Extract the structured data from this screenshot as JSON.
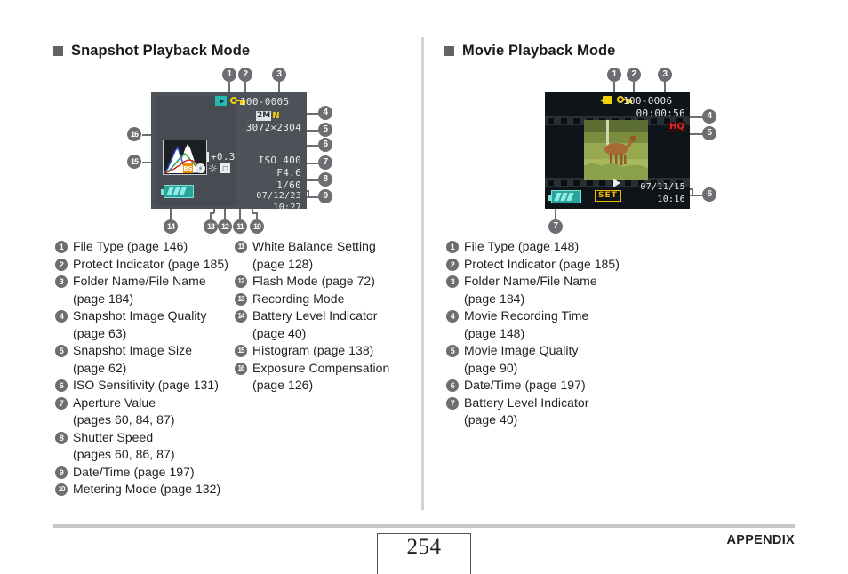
{
  "document": {
    "page_number": "254",
    "footer_label": "APPENDIX"
  },
  "sections": {
    "snapshot": {
      "heading": "Snapshot Playback Mode",
      "lcd": {
        "file_type_icon": "playback-icon",
        "protect_icon": "key-icon",
        "folder_file_name": "100-0005",
        "image_quality_size": "2M",
        "image_quality_letter": "N",
        "image_size": "3072×2304",
        "exposure_compensation": "+0.3",
        "iso": "ISO 400",
        "aperture": "F4.6",
        "shutter_speed": "1/60",
        "date": "07/12/23",
        "time": "10:27",
        "recording_mode_icon": "BS",
        "flash_mode_icon": "flash-off-icon",
        "white_balance_icon": "daylight-icon",
        "metering_mode_icon": "metering-icon",
        "battery_icon": "battery-level-icon",
        "histogram_icon": "histogram-icon"
      },
      "callouts": [
        "1",
        "2",
        "3",
        "4",
        "5",
        "6",
        "7",
        "8",
        "9",
        "10",
        "11",
        "12",
        "13",
        "14",
        "15",
        "16"
      ],
      "index": [
        {
          "num": "1",
          "lines": [
            "File Type (page 146)"
          ]
        },
        {
          "num": "2",
          "lines": [
            "Protect Indicator (page 185)"
          ]
        },
        {
          "num": "3",
          "lines": [
            "Folder Name/File Name",
            "(page 184)"
          ]
        },
        {
          "num": "4",
          "lines": [
            "Snapshot Image Quality",
            "(page 63)"
          ]
        },
        {
          "num": "5",
          "lines": [
            "Snapshot Image Size",
            "(page 62)"
          ]
        },
        {
          "num": "6",
          "lines": [
            "ISO Sensitivity (page 131)"
          ]
        },
        {
          "num": "7",
          "lines": [
            "Aperture Value",
            "(pages 60, 84, 87)"
          ]
        },
        {
          "num": "8",
          "lines": [
            "Shutter Speed",
            "(pages 60, 86, 87)"
          ]
        },
        {
          "num": "9",
          "lines": [
            "Date/Time (page 197)"
          ]
        },
        {
          "num": "10",
          "lines": [
            "Metering Mode (page 132)"
          ]
        }
      ],
      "index2": [
        {
          "num": "11",
          "lines": [
            "White Balance Setting",
            "(page 128)"
          ]
        },
        {
          "num": "12",
          "lines": [
            "Flash Mode (page 72)"
          ]
        },
        {
          "num": "13",
          "lines": [
            "Recording Mode"
          ]
        },
        {
          "num": "14",
          "lines": [
            "Battery Level Indicator",
            "(page 40)"
          ]
        },
        {
          "num": "15",
          "lines": [
            "Histogram (page 138)"
          ]
        },
        {
          "num": "16",
          "lines": [
            "Exposure Compensation",
            "(page 126)"
          ]
        }
      ]
    },
    "movie": {
      "heading": "Movie Playback Mode",
      "lcd": {
        "file_type_icon": "movie-camera-icon",
        "protect_icon": "key-icon",
        "folder_file_name": "100-0006",
        "recording_time": "00:00:56",
        "image_quality": "HQ",
        "date": "07/11/15",
        "time": "10:16",
        "set_label": "SET",
        "play_icon": "play-icon",
        "battery_icon": "battery-level-icon"
      },
      "callouts": [
        "1",
        "2",
        "3",
        "4",
        "5",
        "6",
        "7"
      ],
      "index": [
        {
          "num": "1",
          "lines": [
            "File Type (page 148)"
          ]
        },
        {
          "num": "2",
          "lines": [
            "Protect Indicator (page 185)"
          ]
        },
        {
          "num": "3",
          "lines": [
            "Folder Name/File Name",
            "(page 184)"
          ]
        },
        {
          "num": "4",
          "lines": [
            "Movie Recording Time",
            "(page 148)"
          ]
        },
        {
          "num": "5",
          "lines": [
            "Movie Image Quality",
            "(page 90)"
          ]
        },
        {
          "num": "6",
          "lines": [
            "Date/Time (page 197)"
          ]
        },
        {
          "num": "7",
          "lines": [
            "Battery Level Indicator",
            "(page 40)"
          ]
        }
      ]
    }
  }
}
